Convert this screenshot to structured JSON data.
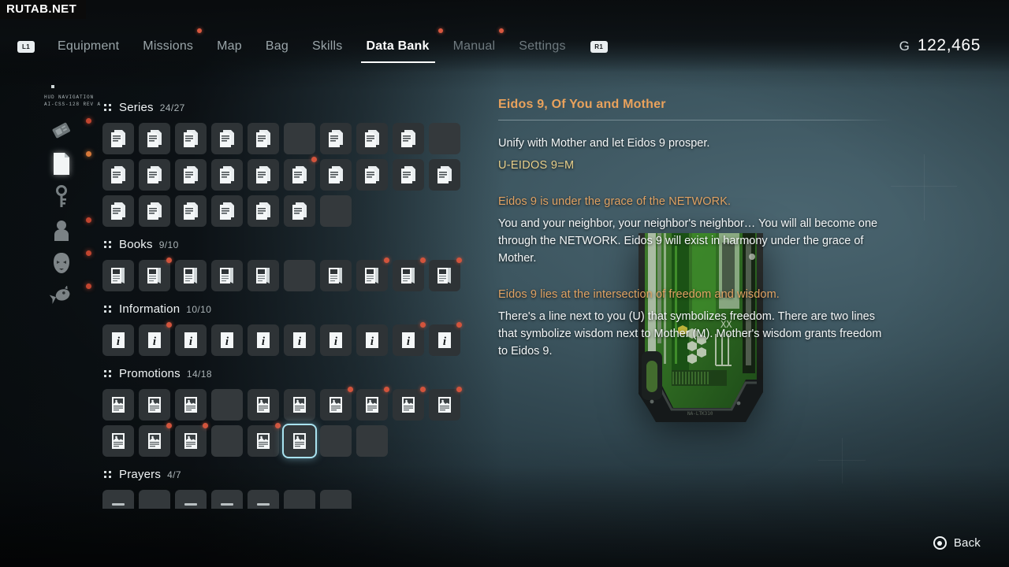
{
  "watermark": "RUTAB.NET",
  "colors": {
    "accent_title": "#e9a25c",
    "accent_code": "#e8cf8a",
    "selection": "#a8e2ef",
    "notification_dot": "#d2543c",
    "text": "#f3f6f7"
  },
  "topbar": {
    "left_bumper": "L1",
    "right_bumper": "R1",
    "items": [
      {
        "label": "Equipment",
        "active": false,
        "dot": false,
        "dim": false
      },
      {
        "label": "Missions",
        "active": false,
        "dot": true,
        "dim": false
      },
      {
        "label": "Map",
        "active": false,
        "dot": false,
        "dim": false
      },
      {
        "label": "Bag",
        "active": false,
        "dot": false,
        "dim": false
      },
      {
        "label": "Skills",
        "active": false,
        "dot": false,
        "dim": false
      },
      {
        "label": "Data Bank",
        "active": true,
        "dot": true,
        "dim": false
      },
      {
        "label": "Manual",
        "active": false,
        "dot": true,
        "dim": true
      },
      {
        "label": "Settings",
        "active": false,
        "dot": false,
        "dim": true
      }
    ],
    "currency": {
      "symbol": "G",
      "amount": "122,465"
    }
  },
  "rail": {
    "code_line1": "HUD NAVIGATION",
    "code_line2": "AI-CSS-128 REV A",
    "items": [
      {
        "icon": "chip-icon",
        "name": "rail-item-chip",
        "selected": false,
        "dot": "red"
      },
      {
        "icon": "document-icon",
        "name": "rail-item-document",
        "selected": true,
        "dot": "warm"
      },
      {
        "icon": "key-icon",
        "name": "rail-item-key",
        "selected": false,
        "dot": "none"
      },
      {
        "icon": "person-icon",
        "name": "rail-item-person",
        "selected": false,
        "dot": "red"
      },
      {
        "icon": "mask-icon",
        "name": "rail-item-mask",
        "selected": false,
        "dot": "red"
      },
      {
        "icon": "creature-icon",
        "name": "rail-item-creature",
        "selected": false,
        "dot": "red"
      }
    ]
  },
  "sections": [
    {
      "title": "Series",
      "count": "24/27",
      "icon": "pages-icon",
      "cells": [
        {
          "state": "filled",
          "dot": false
        },
        {
          "state": "filled",
          "dot": false
        },
        {
          "state": "filled",
          "dot": false
        },
        {
          "state": "filled",
          "dot": false
        },
        {
          "state": "filled",
          "dot": false
        },
        {
          "state": "empty",
          "dot": false
        },
        {
          "state": "filled",
          "dot": false
        },
        {
          "state": "filled",
          "dot": false
        },
        {
          "state": "filled",
          "dot": false
        },
        {
          "state": "empty",
          "dot": false
        },
        {
          "state": "filled",
          "dot": false
        },
        {
          "state": "filled",
          "dot": false
        },
        {
          "state": "filled",
          "dot": false
        },
        {
          "state": "filled",
          "dot": false
        },
        {
          "state": "filled",
          "dot": false
        },
        {
          "state": "filled",
          "dot": true
        },
        {
          "state": "filled",
          "dot": false
        },
        {
          "state": "filled",
          "dot": false
        },
        {
          "state": "filled",
          "dot": false
        },
        {
          "state": "filled",
          "dot": false
        },
        {
          "state": "filled",
          "dot": false
        },
        {
          "state": "filled",
          "dot": false
        },
        {
          "state": "filled",
          "dot": false
        },
        {
          "state": "filled",
          "dot": false
        },
        {
          "state": "filled",
          "dot": false
        },
        {
          "state": "filled",
          "dot": false
        },
        {
          "state": "empty",
          "dot": false
        }
      ]
    },
    {
      "title": "Books",
      "count": "9/10",
      "icon": "book-icon",
      "cells": [
        {
          "state": "filled",
          "dot": false
        },
        {
          "state": "filled",
          "dot": true
        },
        {
          "state": "filled",
          "dot": false
        },
        {
          "state": "filled",
          "dot": false
        },
        {
          "state": "filled",
          "dot": false
        },
        {
          "state": "empty",
          "dot": false
        },
        {
          "state": "filled",
          "dot": false
        },
        {
          "state": "filled",
          "dot": true
        },
        {
          "state": "filled",
          "dot": true
        },
        {
          "state": "filled",
          "dot": true
        }
      ]
    },
    {
      "title": "Information",
      "count": "10/10",
      "icon": "info-icon",
      "cells": [
        {
          "state": "filled",
          "dot": false
        },
        {
          "state": "filled",
          "dot": true
        },
        {
          "state": "filled",
          "dot": false
        },
        {
          "state": "filled",
          "dot": false
        },
        {
          "state": "filled",
          "dot": false
        },
        {
          "state": "filled",
          "dot": false
        },
        {
          "state": "filled",
          "dot": false
        },
        {
          "state": "filled",
          "dot": false
        },
        {
          "state": "filled",
          "dot": true
        },
        {
          "state": "filled",
          "dot": true
        }
      ]
    },
    {
      "title": "Promotions",
      "count": "14/18",
      "icon": "poster-icon",
      "cells": [
        {
          "state": "filled",
          "dot": false
        },
        {
          "state": "filled",
          "dot": false
        },
        {
          "state": "filled",
          "dot": false
        },
        {
          "state": "empty",
          "dot": false
        },
        {
          "state": "filled",
          "dot": false
        },
        {
          "state": "filled",
          "dot": false
        },
        {
          "state": "filled",
          "dot": true
        },
        {
          "state": "filled",
          "dot": true
        },
        {
          "state": "filled",
          "dot": true
        },
        {
          "state": "filled",
          "dot": true
        },
        {
          "state": "filled",
          "dot": false
        },
        {
          "state": "filled",
          "dot": true
        },
        {
          "state": "filled",
          "dot": true
        },
        {
          "state": "empty",
          "dot": false
        },
        {
          "state": "filled",
          "dot": true
        },
        {
          "state": "selected",
          "dot": false
        },
        {
          "state": "empty",
          "dot": false
        },
        {
          "state": "empty",
          "dot": false
        }
      ]
    },
    {
      "title": "Prayers",
      "count": "4/7",
      "icon": "prayer-icon",
      "cells": [
        {
          "state": "filled",
          "dot": false
        },
        {
          "state": "empty",
          "dot": false
        },
        {
          "state": "filled",
          "dot": false
        },
        {
          "state": "filled",
          "dot": false
        },
        {
          "state": "filled",
          "dot": false
        },
        {
          "state": "empty",
          "dot": false
        },
        {
          "state": "empty",
          "dot": false
        }
      ]
    }
  ],
  "detail": {
    "title": "Eidos 9, Of You and Mother",
    "blocks": [
      {
        "kind": "text",
        "value": "Unify with Mother and let Eidos 9 prosper."
      },
      {
        "kind": "code",
        "value": "U-EIDOS 9=M"
      },
      {
        "kind": "spacer",
        "value": ""
      },
      {
        "kind": "head",
        "value": "Eidos 9 is under the grace of the NETWORK."
      },
      {
        "kind": "text",
        "value": "You and your neighbor, your neighbor's neighbor… You will all become one through the NETWORK. Eidos 9 will exist in harmony under the grace of Mother."
      },
      {
        "kind": "spacer",
        "value": ""
      },
      {
        "kind": "head",
        "value": "Eidos 9 lies at the intersection of freedom and wisdom."
      },
      {
        "kind": "text",
        "value": "There's a line next to you (U) that symbolizes freedom. There are two lines that symbolize wisdom next to Mother (M). Mother's wisdom grants freedom to Eidos 9."
      }
    ],
    "artifact_label": "circuit-board-device"
  },
  "footer": {
    "button_glyph": "circle-button-icon",
    "label": "Back"
  }
}
